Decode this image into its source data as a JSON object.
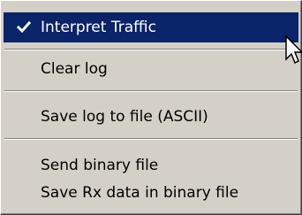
{
  "menu": {
    "items": [
      {
        "label": "Interpret Traffic",
        "checked": true,
        "selected": true
      },
      {
        "label": "Clear log"
      },
      {
        "label": "Save log to file (ASCII)"
      },
      {
        "label": "Send binary file"
      },
      {
        "label": "Save Rx data in binary file"
      }
    ]
  },
  "colors": {
    "menu_bg": "#d4d0c8",
    "highlight": "#0a246a",
    "highlight_text": "#ffffff"
  },
  "icons": {
    "check": "check-icon",
    "cursor": "mouse-pointer-icon"
  }
}
